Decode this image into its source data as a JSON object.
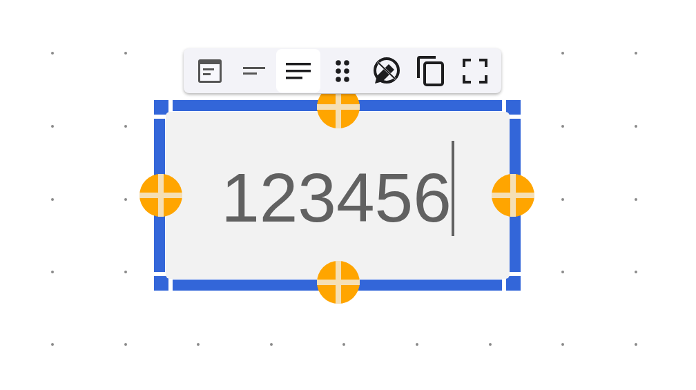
{
  "toolbar": {
    "buttons": [
      {
        "kind": "card",
        "selected": false
      },
      {
        "kind": "short-lines",
        "selected": false
      },
      {
        "kind": "lines",
        "selected": true
      },
      {
        "kind": "drag",
        "selected": false
      },
      {
        "kind": "no-edit",
        "selected": false
      },
      {
        "kind": "copy",
        "selected": false
      },
      {
        "kind": "fullscreen",
        "selected": false
      }
    ]
  },
  "text_box": {
    "value": "123456",
    "editing": true,
    "selected": true
  }
}
